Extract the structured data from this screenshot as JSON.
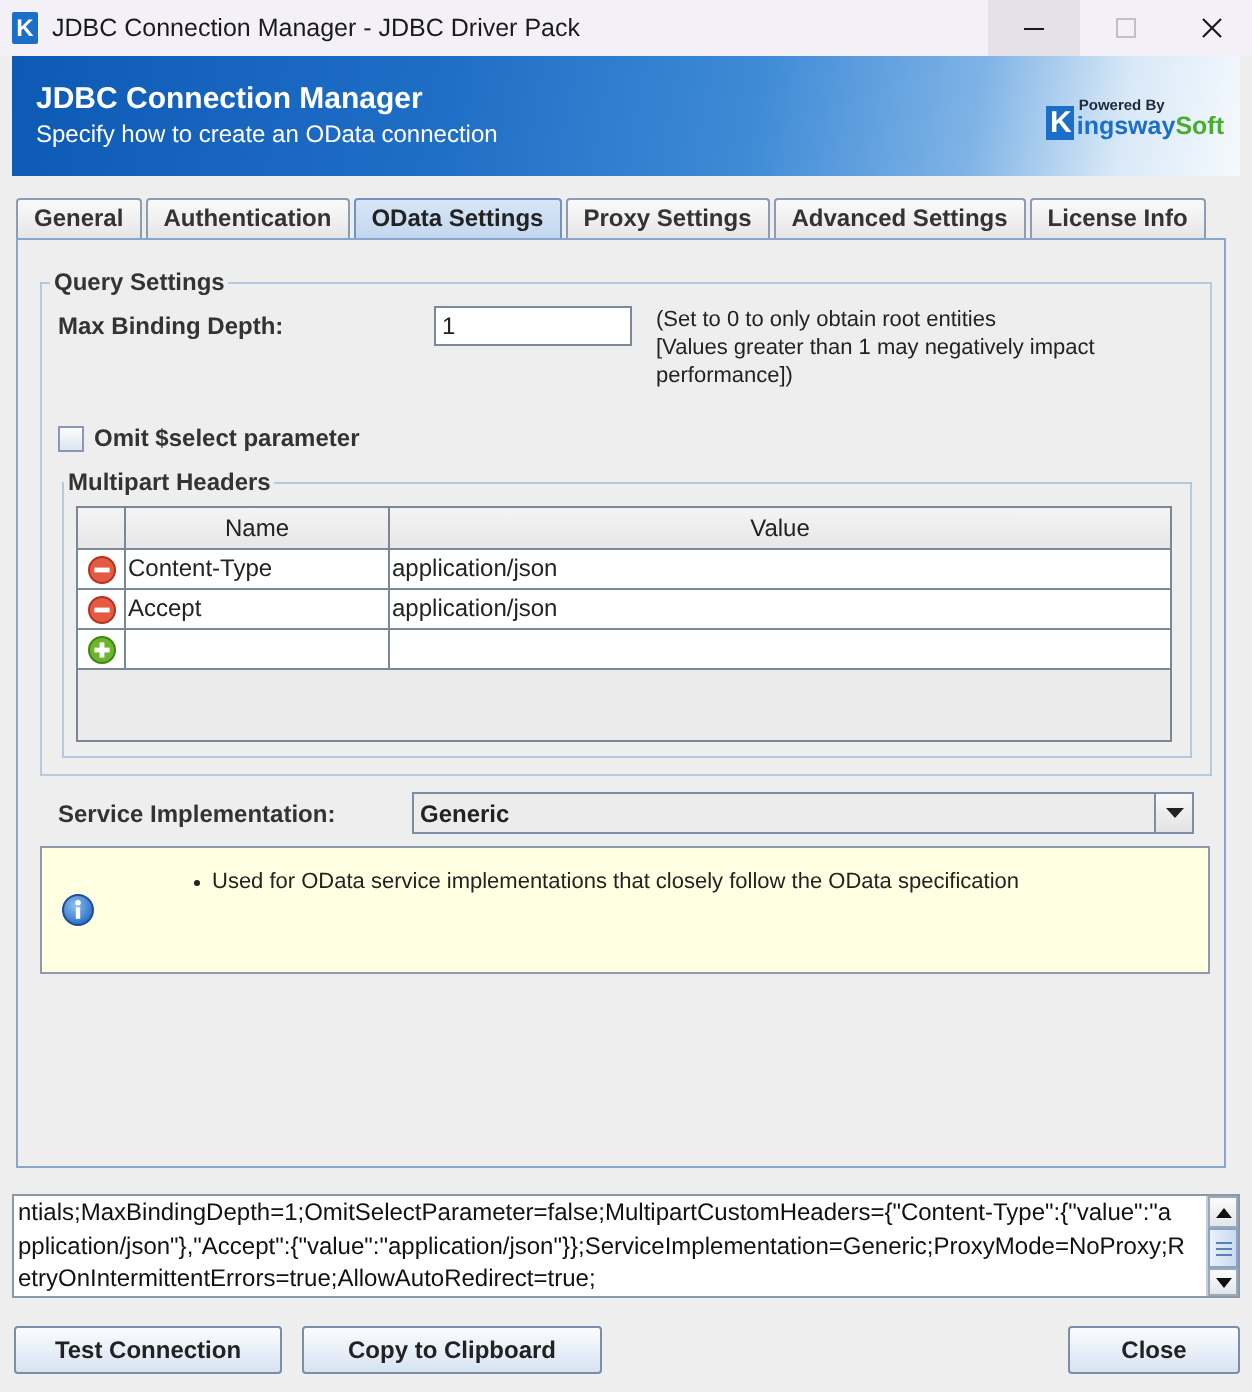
{
  "window": {
    "icon_text": "K",
    "title": "JDBC Connection Manager - JDBC Driver Pack",
    "controls": [
      {
        "kind": "minimize",
        "hovered": true,
        "disabled": false
      },
      {
        "kind": "maximize",
        "hovered": false,
        "disabled": true
      },
      {
        "kind": "close",
        "hovered": false,
        "disabled": false
      }
    ]
  },
  "header": {
    "title": "JDBC Connection Manager",
    "subtitle": "Specify how to create an OData connection",
    "logo": {
      "tagline": "Powered By",
      "initial": "K",
      "name": "ingsway",
      "suffix": "Soft"
    }
  },
  "tabs": [
    {
      "label": "General",
      "selected": false
    },
    {
      "label": "Authentication",
      "selected": false
    },
    {
      "label": "OData Settings",
      "selected": true
    },
    {
      "label": "Proxy Settings",
      "selected": false
    },
    {
      "label": "Advanced Settings",
      "selected": false
    },
    {
      "label": "License Info",
      "selected": false
    }
  ],
  "query_settings": {
    "title": "Query Settings",
    "max_binding_depth": {
      "label": "Max Binding Depth:",
      "value": "1",
      "hint": "(Set to 0 to only obtain root entities\n[Values greater than 1 may negatively impact performance])"
    },
    "omit_select": {
      "label": "Omit $select parameter",
      "checked": false
    },
    "multipart_headers": {
      "title": "Multipart Headers",
      "columns": [
        "Name",
        "Value"
      ],
      "rows": [
        {
          "kind": "entry",
          "name": "Content-Type",
          "value": "application/json"
        },
        {
          "kind": "entry",
          "name": "Accept",
          "value": "application/json"
        },
        {
          "kind": "new"
        }
      ]
    }
  },
  "service_implementation": {
    "label": "Service Implementation:",
    "value": "Generic",
    "notes": [
      "Used for OData service implementations that closely follow the OData specification"
    ]
  },
  "connection_string": {
    "lines": [
      "ntials;MaxBindingDepth=1;OmitSelectParameter=false;MultipartCustomHeaders={\"Content-Type\":{\"value\":\"a",
      "pplication/json\"},\"Accept\":{\"value\":\"application/json\"}};ServiceImplementation=Generic;ProxyMode=NoProxy;R",
      "etryOnIntermittentErrors=true;AllowAutoRedirect=true;"
    ]
  },
  "buttons": [
    {
      "kind": "test",
      "label": "Test Connection"
    },
    {
      "kind": "copy",
      "label": "Copy to Clipboard"
    },
    {
      "kind": "close",
      "label": "Close"
    }
  ]
}
